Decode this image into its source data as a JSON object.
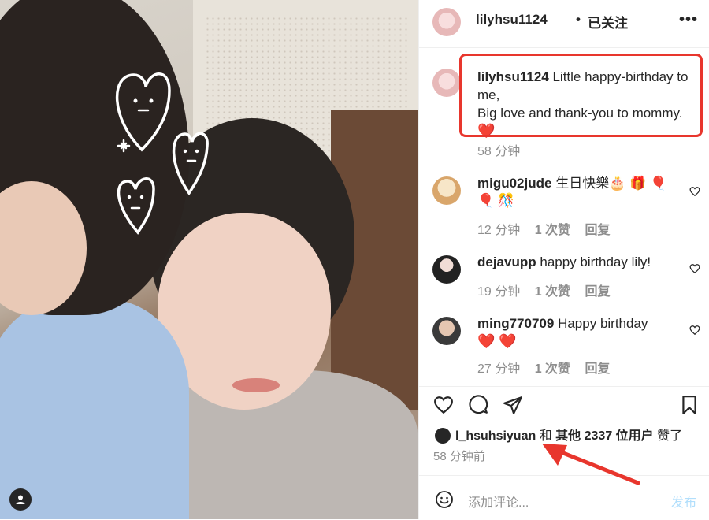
{
  "post": {
    "owner": "lilyhsu1124",
    "dot": "•",
    "follow_state": "已关注",
    "more": "•••",
    "caption_user": "lilyhsu1124",
    "caption_line1": "Little happy-birthday to me,",
    "caption_line2": "Big love and thank-you to mommy.",
    "caption_emoji": "❤️",
    "caption_time": "58 分钟"
  },
  "comments": [
    {
      "user": "migu02jude",
      "text": "生日快樂🎂 🎁 🎈",
      "text2": "🎈 🎊",
      "time": "12 分钟",
      "likes": "1 次赞",
      "reply": "回复"
    },
    {
      "user": "dejavupp",
      "text": "happy birthday lily!",
      "text2": "",
      "time": "19 分钟",
      "likes": "1 次赞",
      "reply": "回复"
    },
    {
      "user": "ming770709",
      "text": "Happy birthday",
      "text2": "❤️ ❤️",
      "time": "27 分钟",
      "likes": "1 次赞",
      "reply": "回复"
    }
  ],
  "likes": {
    "user": "l_hsuhsiyuan",
    "and": "和",
    "others": "其他 2337 位用户",
    "liked": "赞了"
  },
  "post_time": "58 分钟前",
  "comment_bar": {
    "placeholder": "添加评论...",
    "post_label": "发布"
  },
  "colors": {
    "highlight": "#e8362d",
    "text": "#262626",
    "muted": "#8e8e8e",
    "post_disabled": "#b2dffc"
  }
}
